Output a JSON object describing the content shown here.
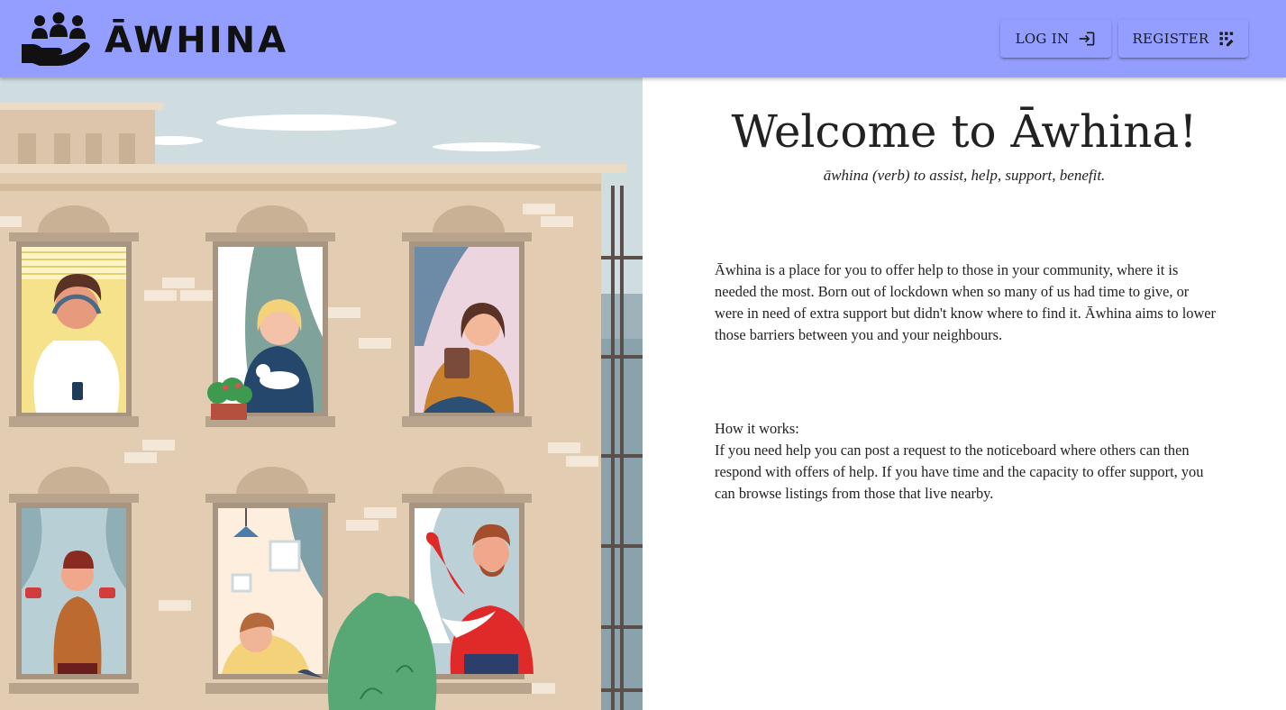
{
  "app": {
    "name": "ĀWHINA"
  },
  "header": {
    "login_label": "LOG IN",
    "register_label": "REGISTER"
  },
  "main": {
    "title": "Welcome to Āwhina!",
    "tagline": "āwhina (verb) to assist, help, support, benefit.",
    "intro": "Āwhina is a place for you to offer help to those in your community, where it is needed the most. Born out of lockdown when so many of us had time to give, or were in need of extra support but didn't know where to find it. Āwhina aims to lower those barriers between you and your neighbours.",
    "how_heading": "How it works:",
    "how_body": "If you need help you can post a request to the noticeboard where others can then respond with offers of help. If you have time and the capacity to offer support, you can browse listings from those that live nearby."
  },
  "icons": {
    "logo": "people-in-hand-icon",
    "login": "login-arrow-icon",
    "register": "app-registration-icon"
  },
  "colors": {
    "appbar": "#939eff",
    "text": "#222222",
    "background": "#ffffff",
    "sky": "#cfdde0",
    "building": "#e3cdb2"
  }
}
